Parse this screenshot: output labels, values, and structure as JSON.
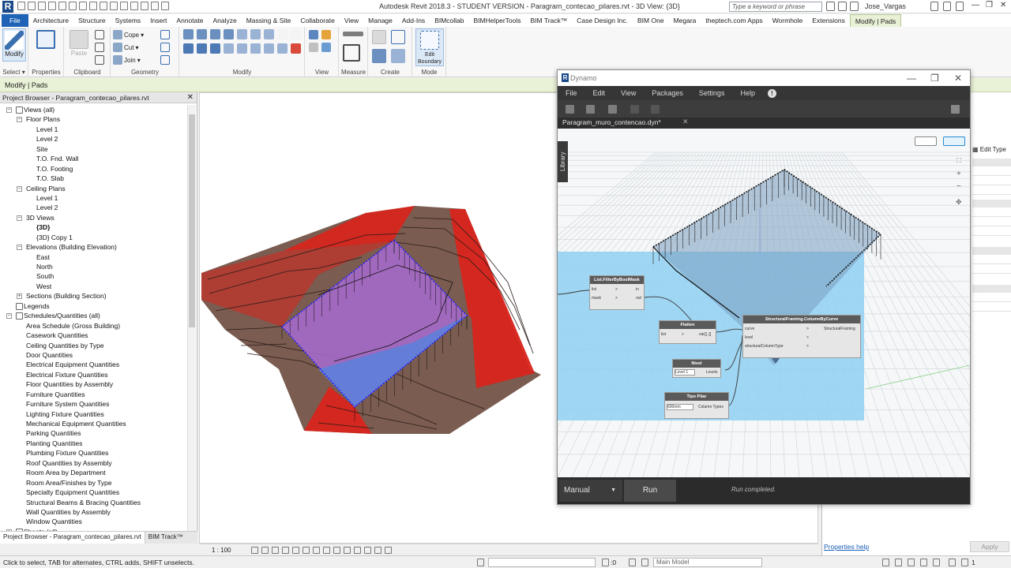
{
  "app": {
    "logo": "R",
    "title": "Autodesk Revit 2018.3 - STUDENT VERSION -   Paragram_contecao_pilares.rvt - 3D View: {3D}",
    "search_placeholder": "Type a keyword or phrase",
    "user": "Jose_Vargas",
    "win_min": "—",
    "win_max": "❐",
    "win_close": "✕"
  },
  "ribbon_tabs": [
    "File",
    "Architecture",
    "Structure",
    "Systems",
    "Insert",
    "Annotate",
    "Analyze",
    "Massing & Site",
    "Collaborate",
    "View",
    "Manage",
    "Add-Ins",
    "BIMcollab",
    "BIMHelperTools",
    "BIM Track™",
    "Case Design Inc.",
    "BIM One",
    "Megara",
    "theptech.com Apps",
    "Wormhole",
    "Extensions",
    "Modify | Pads"
  ],
  "ribbon": {
    "modify_label": "Modify",
    "select_label": "Select ▾",
    "properties_label": "Properties",
    "paste_label": "Paste",
    "clipboard_label": "Clipboard",
    "cope_label": "Cope",
    "cut_label": "Cut",
    "join_label": "Join",
    "geometry_label": "Geometry",
    "modify_panel_label": "Modify",
    "view_label": "View",
    "measure_label": "Measure",
    "create_label": "Create",
    "edit_boundary_label": "Edit Boundary",
    "mode_label": "Mode"
  },
  "context_bar": "Modify | Pads",
  "project_browser": {
    "title": "Project Browser - Paragram_contecao_pilares.rvt",
    "close": "✕",
    "tree": [
      {
        "label": "Views (all)",
        "level": 0,
        "expander": "−"
      },
      {
        "label": "Floor Plans",
        "level": 1,
        "expander": "−"
      },
      {
        "label": "Level 1",
        "level": 2
      },
      {
        "label": "Level 2",
        "level": 2
      },
      {
        "label": "Site",
        "level": 2
      },
      {
        "label": "T.O. Fnd. Wall",
        "level": 2
      },
      {
        "label": "T.O. Footing",
        "level": 2
      },
      {
        "label": "T.O. Slab",
        "level": 2
      },
      {
        "label": "Ceiling Plans",
        "level": 1,
        "expander": "−"
      },
      {
        "label": "Level 1",
        "level": 2
      },
      {
        "label": "Level 2",
        "level": 2
      },
      {
        "label": "3D Views",
        "level": 1,
        "expander": "−"
      },
      {
        "label": "{3D}",
        "level": 2,
        "bold": true
      },
      {
        "label": "{3D} Copy 1",
        "level": 2
      },
      {
        "label": "Elevations (Building Elevation)",
        "level": 1,
        "expander": "−"
      },
      {
        "label": "East",
        "level": 2
      },
      {
        "label": "North",
        "level": 2
      },
      {
        "label": "South",
        "level": 2
      },
      {
        "label": "West",
        "level": 2
      },
      {
        "label": "Sections (Building Section)",
        "level": 1,
        "expander": "+"
      },
      {
        "label": "Legends",
        "level": 0
      },
      {
        "label": "Schedules/Quantities (all)",
        "level": 0,
        "expander": "−"
      },
      {
        "label": "Area Schedule (Gross Building)",
        "level": 1
      },
      {
        "label": "Casework Quantities",
        "level": 1
      },
      {
        "label": "Ceiling Quantities by Type",
        "level": 1
      },
      {
        "label": "Door Quantities",
        "level": 1
      },
      {
        "label": "Electrical Equipment Quantities",
        "level": 1
      },
      {
        "label": "Electrical Fixture Quantities",
        "level": 1
      },
      {
        "label": "Floor Quantities by Assembly",
        "level": 1
      },
      {
        "label": "Furniture Quantities",
        "level": 1
      },
      {
        "label": "Furniture System Quantities",
        "level": 1
      },
      {
        "label": "Lighting Fixture Quantities",
        "level": 1
      },
      {
        "label": "Mechanical Equipment Quantities",
        "level": 1
      },
      {
        "label": "Parking Quantities",
        "level": 1
      },
      {
        "label": "Planting Quantities",
        "level": 1
      },
      {
        "label": "Plumbing Fixture Quantities",
        "level": 1
      },
      {
        "label": "Roof Quantities by Assembly",
        "level": 1
      },
      {
        "label": "Room Area by Department",
        "level": 1
      },
      {
        "label": "Room Area/Finishes by Type",
        "level": 1
      },
      {
        "label": "Specialty Equipment Quantities",
        "level": 1
      },
      {
        "label": "Structural Beams & Bracing Quantities",
        "level": 1
      },
      {
        "label": "Wall Quantities by Assembly",
        "level": 1
      },
      {
        "label": "Window Quantities",
        "level": 1
      },
      {
        "label": "Sheets (all)",
        "level": 0,
        "expander": "+"
      }
    ],
    "bottom_tab_1": "Project Browser - Paragram_contecao_pilares.rvt",
    "bottom_tab_2": "BIM Track™"
  },
  "view": {
    "scale": "1 : 100"
  },
  "properties": {
    "edit_type": "Edit Type",
    "help_link": "Properties help",
    "apply": "Apply"
  },
  "statusbar": {
    "hint": "Click to select, TAB for alternates, CTRL adds, SHIFT unselects.",
    "count": ":0",
    "model": "Main Model",
    "filter_count": "1"
  },
  "dynamo": {
    "title": "Dynamo",
    "menu": [
      "File",
      "Edit",
      "View",
      "Packages",
      "Settings",
      "Help"
    ],
    "warn": "!",
    "tab": "Paragram_muro_contencao.dyn*",
    "tab_close": "✕",
    "library": "Library",
    "run_mode": "Manual",
    "run_button": "Run",
    "run_status": "Run completed.",
    "nodes": {
      "filter": {
        "title": "List.FilterByBoolMask",
        "in1": "list",
        "in2": "mask",
        "out1": "in",
        "out2": "out"
      },
      "flatten": {
        "title": "Flatten",
        "in1": "list",
        "out1": "var[]..[]"
      },
      "nivel": {
        "title": "Nivel",
        "in1": "Level 1",
        "out1": "Levels"
      },
      "tipo": {
        "title": "Tipo Pilar",
        "in1": "600mm",
        "out1": "Column Types"
      },
      "column": {
        "title": "StructuralFraming.ColumnByCurve",
        "in1": "curve",
        "in2": "level",
        "in3": "structuralColumnType",
        "out1": "StructuralFraming"
      }
    }
  },
  "colors": {
    "accent_blue": "#1e63b5",
    "terrain": "#7a5c50",
    "cut_red": "#d8241c",
    "pad_purple": "#a86bd0",
    "pad_blue": "#5d7fd8",
    "dynamo_group": "#8fd0f2"
  }
}
